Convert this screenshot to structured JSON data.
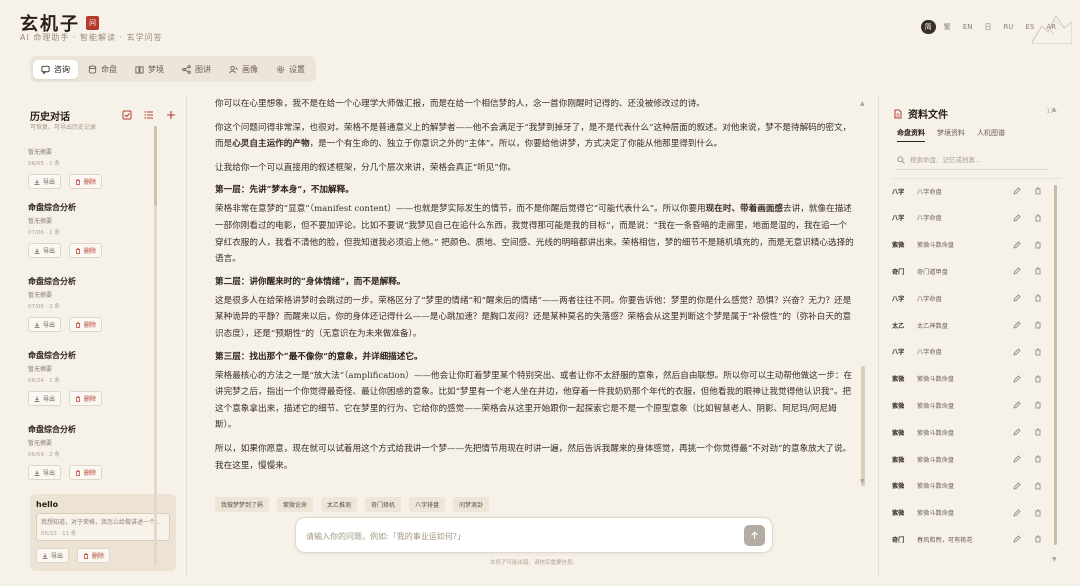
{
  "brand": {
    "title": "玄机子",
    "seal": "问",
    "subtitle": "AI 命理助手 · 智能解读 · 玄学问答"
  },
  "languages": [
    "简",
    "繁",
    "EN",
    "日",
    "RU",
    "ES",
    "AR"
  ],
  "tabs": [
    {
      "label": "咨询",
      "icon": "chat-icon"
    },
    {
      "label": "命盘",
      "icon": "database-icon"
    },
    {
      "label": "梦境",
      "icon": "book-icon"
    },
    {
      "label": "图讲",
      "icon": "graph-icon"
    },
    {
      "label": "画像",
      "icon": "user-portrait-icon"
    },
    {
      "label": "设置",
      "icon": "gear-icon"
    }
  ],
  "sidebar": {
    "title": "历史对话",
    "subtitle": "可恢复、可导出历史记录",
    "export_label": "导出",
    "delete_label": "删除",
    "items": [
      {
        "title": "",
        "summary": "暂无摘要",
        "meta": "06/05 · 1 条"
      },
      {
        "title": "命盘综合分析",
        "summary": "暂无摘要",
        "meta": "07/06 · 1 条"
      },
      {
        "title": "命盘综合分析",
        "summary": "暂无摘要",
        "meta": "07/06 · 2 条"
      },
      {
        "title": "命盘综合分析",
        "summary": "暂无摘要",
        "meta": "06/24 · 1 条"
      },
      {
        "title": "命盘综合分析",
        "summary": "暂无摘要",
        "meta": "06/09 · 2 条"
      },
      {
        "title": "hello",
        "summary": "我想知道，对于荣格，我怎么给做讲述一个…",
        "meta": "05/22 · 11 条"
      }
    ]
  },
  "chat": {
    "p0": "你可以在心里想象，我不是在给一个心理学大师做汇报，而是在给一个相信梦的人，念一首你刚醒时记得的、还没被修改过的诗。",
    "p1a": "你这个问题问得非常深，也很对。荣格不是普通意义上的解梦者——他不会满足于“我梦到掉牙了，是不是代表什么”这种层面的叙述。对他来说，梦不是待解码的密文，而是",
    "p1b": "心灵自主运作的产物",
    "p1c": "，是一个有生命的、独立于你意识之外的“主体”。所以，你要给他讲梦，方式决定了你能从他那里得到什么。",
    "p2": "让我给你一个可以直接用的叙述框架，分几个层次来讲，荣格会真正“听见”你。",
    "h1": "第一层：先讲“梦本身”，不加解释。",
    "p3a": "荣格非常在意梦的“显意”（manifest content）——也就是梦实际发生的情节，而不是你醒后觉得它“可能代表什么”。所以你要用",
    "p3b": "现在时、带着画面感",
    "p3c": "去讲，就像在描述一部你刚看过的电影，但不要加评论。比如不要说“我梦见自己在追什么东西，我觉得那可能是我的目标”，而是说：“我在一条昏暗的走廊里，地面是湿的，我在追一个穿红衣服的人，我看不清他的脸，但我知道我必须追上他。” 把颜色、质地、空间感、光线的明暗都讲出来。荣格相信，梦的细节不是随机填充的，而是无意识精心选择的语言。",
    "h2": "第二层：讲你醒来时的“身体情绪”，而不是解释。",
    "p4": "这是很多人在给荣格讲梦时会跳过的一步。荣格区分了“梦里的情绪”和“醒来后的情绪”——两者往往不同。你要告诉他：梦里的你是什么感觉？恐惧？兴奋？无力？还是某种诡异的平静？而醒来以后，你的身体还记得什么——是心跳加速？是胸口发闷？还是某种莫名的失落感？荣格会从这里判断这个梦是属于“补偿性”的（弥补白天的意识态度），还是“预期性”的（无意识在为未来做准备）。",
    "h3": "第三层：找出那个“最不像你”的意象，并详细描述它。",
    "p5": "荣格最核心的方法之一是“放大法”（amplification）——他会让你盯着梦里某个特别突出、或者让你不太舒服的意象，然后自由联想。所以你可以主动帮他做这一步：在讲完梦之后，指出一个你觉得最奇怪、最让你困惑的意象。比如“梦里有一个老人坐在井边，他穿着一件我奶奶那个年代的衣服，但他看我的眼神让我觉得他认识我”。把这个意象拿出来，描述它的细节、它在梦里的行为、它给你的感觉——荣格会从这里开始跟你一起探索它是不是一个原型意象（比如智慧老人、阴影、阿尼玛/阿尼姆斯）。",
    "p6": "所以，如果你愿意，现在就可以试着用这个方式给我讲一个梦——先把情节用现在时讲一遍，然后告诉我醒来的身体感觉，再挑一个你觉得最“不对劲”的意象放大了说。我在这里，慢慢来。"
  },
  "chips": [
    "我做梦梦到了蚂",
    "紫微论命",
    "太乙推测",
    "奇门择机",
    "八字排盘",
    "问梦测卦"
  ],
  "input": {
    "placeholder": "请输入你的问题，例如:「我的事业运如何?」",
    "value": ""
  },
  "disclaimer": "玄机子可能出错，请核实重要信息。",
  "rpanel": {
    "title": "资料文件",
    "count": "17",
    "tabs": [
      "命盘资料",
      "梦境资料",
      "人机图谱"
    ],
    "search_placeholder": "搜索命盘、记忆或档案…",
    "files": [
      {
        "cat": "八字",
        "name": "八字命盘"
      },
      {
        "cat": "八字",
        "name": "八字命盘"
      },
      {
        "cat": "紫微",
        "name": "紫微斗数命盘"
      },
      {
        "cat": "奇门",
        "name": "奇门遁甲盘"
      },
      {
        "cat": "八字",
        "name": "八字命盘"
      },
      {
        "cat": "太乙",
        "name": "太乙神数盘"
      },
      {
        "cat": "八字",
        "name": "八字命盘"
      },
      {
        "cat": "紫微",
        "name": "紫微斗数命盘"
      },
      {
        "cat": "紫微",
        "name": "紫微斗数命盘"
      },
      {
        "cat": "紫微",
        "name": "紫微斗数命盘"
      },
      {
        "cat": "紫微",
        "name": "紫微斗数命盘"
      },
      {
        "cat": "紫微",
        "name": "紫微斗数命盘"
      },
      {
        "cat": "紫微",
        "name": "紫微斗数命盘"
      },
      {
        "cat": "奇门",
        "name": "春风和煦，可有桃花"
      }
    ]
  },
  "colors": {
    "accent": "#b53a2c",
    "ink": "#2a211a",
    "paper": "#f6f1e9"
  }
}
